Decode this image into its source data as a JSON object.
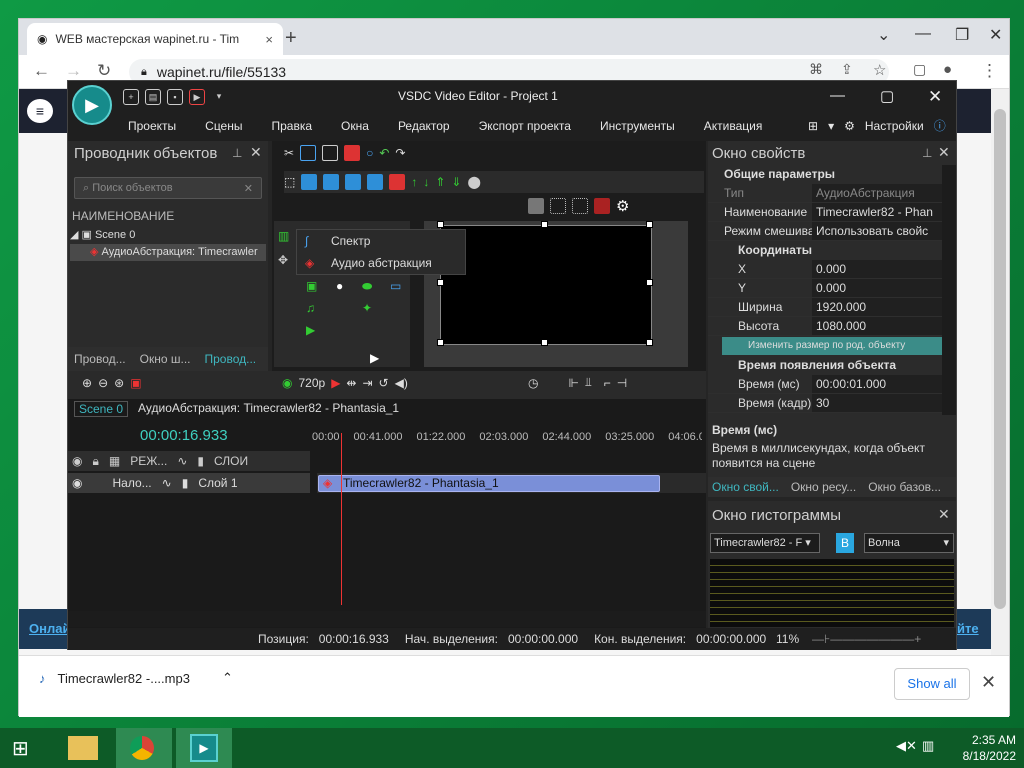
{
  "browser": {
    "tab_title": "WEB мастерская wapinet.ru - Tim",
    "tab_close": "×",
    "new_tab": "+",
    "url": "wapinet.ru/file/55133",
    "site_link_left": "Онлай",
    "site_link_right": "йте",
    "download_file": "Timecrawler82 -....mp3",
    "show_all": "Show all",
    "close": "✕"
  },
  "app": {
    "title": "VSDC Video Editor - Project 1",
    "menu": [
      "Проекты",
      "Сцены",
      "Правка",
      "Окна",
      "Редактор",
      "Экспорт проекта",
      "Инструменты",
      "Активация"
    ],
    "settings": "Настройки",
    "explorer": {
      "title": "Проводник объектов",
      "search_placeholder": "Поиск объектов",
      "column": "НАИМЕНОВАНИЕ",
      "items": [
        "Scene 0",
        "АудиоАбстракция: Timecrawler"
      ],
      "tabs": [
        "Провод...",
        "Окно ш...",
        "Провод..."
      ]
    },
    "context_menu": [
      "Спектр",
      "Аудио абстракция"
    ],
    "preview": {
      "resolution": "720p"
    },
    "timeline": {
      "tabs": [
        "Scene 0",
        "АудиоАбстракция: Timecrawler82 - Phantasia_1"
      ],
      "time": "00:00:16.933",
      "ruler": [
        "00:00",
        "00:41.000",
        "01:22.000",
        "02:03.000",
        "02:44.000",
        "03:25.000",
        "04:06.000"
      ],
      "header": {
        "mode": "РЕЖ...",
        "layers": "СЛОИ"
      },
      "row": {
        "blend": "Нало...",
        "layer": "Слой 1"
      },
      "clip": "Timecrawler82 - Phantasia_1"
    },
    "properties": {
      "title": "Окно свойств",
      "general": "Общие параметры",
      "rows": [
        {
          "k": "Тип",
          "v": "АудиоАбстракция"
        },
        {
          "k": "Наименование",
          "v": "Timecrawler82 - Phan"
        },
        {
          "k": "Режим смешиван",
          "v": "Использовать свойс"
        }
      ],
      "coords": "Координаты",
      "coord_rows": [
        {
          "k": "X",
          "v": "0.000"
        },
        {
          "k": "Y",
          "v": "0.000"
        },
        {
          "k": "Ширина",
          "v": "1920.000"
        },
        {
          "k": "Высота",
          "v": "1080.000"
        }
      ],
      "resize_btn": "Изменить размер по род. объекту",
      "appear": "Время появления объекта",
      "appear_rows": [
        {
          "k": "Время (мс)",
          "v": "00:00:01.000"
        },
        {
          "k": "Время (кадр)",
          "v": "30"
        }
      ],
      "help_title": "Время (мс)",
      "help_text": "Время в миллисекундах, когда объект появится на сцене",
      "tabs": [
        "Окно свой...",
        "Окно ресу...",
        "Окно базов..."
      ]
    },
    "histogram": {
      "title": "Окно гистограммы",
      "source": "Timecrawler82 - F",
      "b": "B",
      "mode": "Волна"
    },
    "status": {
      "position_label": "Позиция:",
      "position": "00:00:16.933",
      "sel_start_label": "Нач. выделения:",
      "sel_start": "00:00:00.000",
      "sel_end_label": "Кон. выделения:",
      "sel_end": "00:00:00.000",
      "zoom": "11%"
    }
  },
  "taskbar": {
    "time": "2:35 AM",
    "date": "8/18/2022"
  }
}
